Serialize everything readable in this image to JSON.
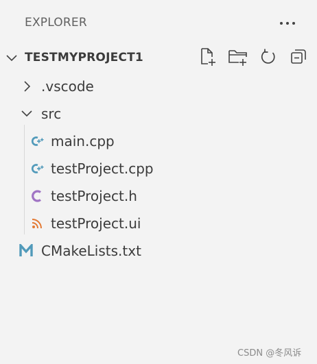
{
  "explorer": {
    "title": "EXPLORER",
    "more_icon": "ellipsis-icon"
  },
  "project": {
    "name": "TESTMYPROJECT1",
    "expanded": true,
    "actions": [
      {
        "name": "new-file-button",
        "icon": "new-file-icon"
      },
      {
        "name": "new-folder-button",
        "icon": "new-folder-icon"
      },
      {
        "name": "refresh-button",
        "icon": "refresh-icon"
      },
      {
        "name": "collapse-all-button",
        "icon": "collapse-all-icon"
      }
    ]
  },
  "tree": {
    "vscode": {
      "label": ".vscode",
      "type": "folder",
      "expanded": false
    },
    "src": {
      "label": "src",
      "type": "folder",
      "expanded": true
    },
    "main_cpp": {
      "label": "main.cpp",
      "icon": "cpp-icon",
      "color": "#519aba"
    },
    "testproject_cpp": {
      "label": "testProject.cpp",
      "icon": "cpp-icon",
      "color": "#519aba"
    },
    "testproject_h": {
      "label": "testProject.h",
      "icon": "c-header-icon",
      "color": "#a074c4"
    },
    "testproject_ui": {
      "label": "testProject.ui",
      "icon": "rss-icon",
      "color": "#e37933"
    },
    "cmakelists": {
      "label": "CMakeLists.txt",
      "icon": "cmake-icon",
      "color": "#519aba"
    }
  },
  "watermark": "CSDN @冬风诉"
}
